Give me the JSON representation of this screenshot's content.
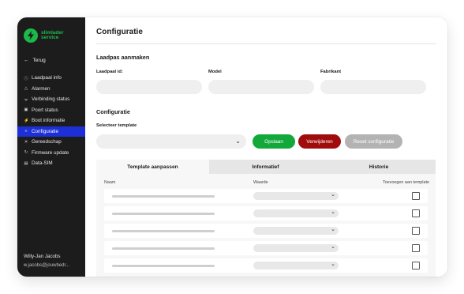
{
  "sidebar": {
    "logo_line1": "slimlader",
    "logo_line2": "service",
    "back_label": "Terug",
    "items": [
      {
        "label": "Laadpaal info",
        "icon": "info-icon"
      },
      {
        "label": "Alarmen",
        "icon": "alert-triangle-icon"
      },
      {
        "label": "Verbinding status",
        "icon": "wifi-icon"
      },
      {
        "label": "Poort status",
        "icon": "port-icon"
      },
      {
        "label": "Boot informatie",
        "icon": "plug-icon"
      },
      {
        "label": "Configuratie",
        "icon": "sliders-icon",
        "active": true
      },
      {
        "label": "Gereedschap",
        "icon": "tools-icon"
      },
      {
        "label": "Firmware update",
        "icon": "refresh-icon"
      },
      {
        "label": "Data-SIM",
        "icon": "sim-icon"
      }
    ],
    "user_name": "Willy-Jan Jacobs",
    "user_email": "w.jacobs@jouwbedr..."
  },
  "main": {
    "title": "Configuratie",
    "charger_section": {
      "heading": "Laadpas aanmaken",
      "fields": [
        {
          "label": "Laadpaal id:",
          "value": ""
        },
        {
          "label": "Model",
          "value": ""
        },
        {
          "label": "Fabrikant",
          "value": ""
        }
      ]
    },
    "config_section": {
      "heading": "Configuratie",
      "template_label": "Selecteer template",
      "template_value": "",
      "buttons": {
        "save": "Opslaan",
        "delete": "Verwijderen",
        "reset": "Reset configuratie"
      }
    },
    "tabs": [
      {
        "label": "Template aanpassen",
        "active": true
      },
      {
        "label": "Informatief",
        "active": false
      },
      {
        "label": "Historie",
        "active": false
      }
    ],
    "table": {
      "columns": {
        "name": "Naam",
        "value": "Waarde",
        "add": "Toevoegen aan template"
      },
      "row_count": 5
    }
  },
  "colors": {
    "sidebar_bg": "#1c1c1c",
    "brand_green": "#1db84a",
    "active_blue": "#1d2fd6",
    "save_green": "#12a83a",
    "delete_red": "#a00c0c",
    "reset_gray": "#b3b3b3"
  }
}
